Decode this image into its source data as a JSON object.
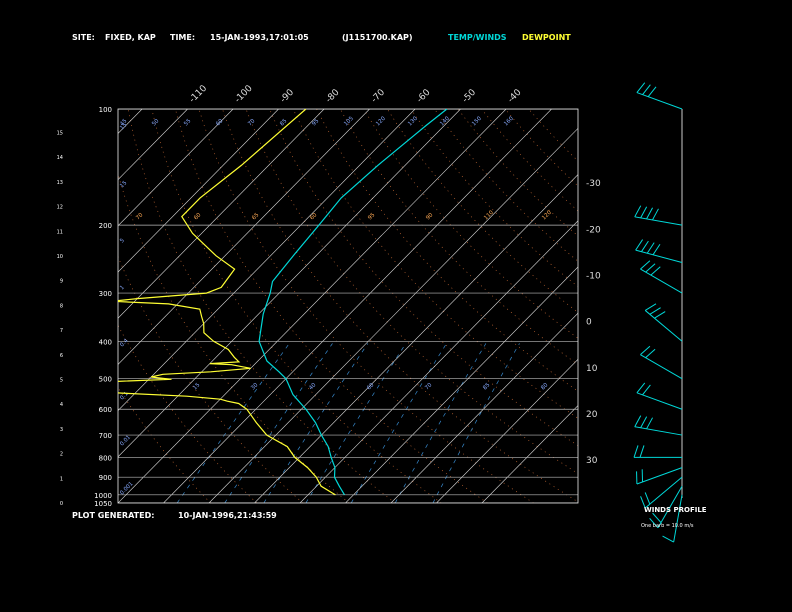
{
  "header": {
    "site_label": "SITE:",
    "site_value": "FIXED, KAP",
    "time_label": "TIME:",
    "time_value": "15-JAN-1993,17:01:05",
    "file_name": "(J1151700.KAP)",
    "temp_legend": "TEMP/WINDS",
    "dew_legend": "DEWPOINT"
  },
  "footer": {
    "generated_label": "PLOT GENERATED:",
    "generated_value": "10-JAN-1996,21:43:59",
    "winds_title": "WINDS PROFILE",
    "winds_note": "One barb = 10.0 m/s"
  },
  "colors": {
    "background": "#000000",
    "temperature": "#00d8d8",
    "dewpoint": "#ffff33",
    "isobar": "#bbbbbb",
    "isotherm": "#dddddd",
    "dry_adiabat": "#ff8844",
    "moist_adiabat": "#ffaa55",
    "mixing_ratio": "#44aaff",
    "labels": "#ffffff"
  },
  "chart_data": {
    "type": "line",
    "pressure_ticks": [
      "100",
      "200",
      "300",
      "400",
      "500",
      "600",
      "700",
      "800",
      "900",
      "1000",
      "1050"
    ],
    "height_ticks": [
      "0",
      "1",
      "2",
      "3",
      "4",
      "5",
      "6",
      "7",
      "8",
      "9",
      "10",
      "11",
      "12",
      "13",
      "14",
      "15"
    ],
    "isotherm_labels": [
      "-110",
      "-100",
      "-90",
      "-80",
      "-70",
      "-60",
      "-50",
      "-40",
      "-30",
      "-20",
      "-10",
      "0",
      "10",
      "20",
      "30"
    ],
    "mixing_ratio_labels": [
      "15",
      "15",
      "5",
      "1",
      "0.4",
      "0.1",
      "0.01",
      "0.001"
    ],
    "theta_labels_top": [
      "45",
      "50",
      "55",
      "60",
      "70",
      "85",
      "95",
      "105",
      "120",
      "130",
      "140",
      "150",
      "160"
    ],
    "theta_labels_mid": [
      "70",
      "60",
      "65",
      "60",
      "95",
      "90",
      "110",
      "120"
    ],
    "theta_labels_low": [
      "15",
      "30",
      "40",
      "60",
      "70",
      "85",
      "80"
    ],
    "series": [
      {
        "name": "TEMP/WINDS",
        "points": [
          [
            100,
            -53
          ],
          [
            110,
            -54
          ],
          [
            140,
            -56
          ],
          [
            170,
            -57
          ],
          [
            200,
            -56
          ],
          [
            240,
            -55
          ],
          [
            280,
            -54
          ],
          [
            300,
            -52
          ],
          [
            340,
            -49
          ],
          [
            400,
            -44
          ],
          [
            450,
            -38
          ],
          [
            480,
            -33
          ],
          [
            500,
            -30
          ],
          [
            550,
            -25
          ],
          [
            600,
            -19
          ],
          [
            650,
            -14
          ],
          [
            700,
            -10
          ],
          [
            750,
            -6
          ],
          [
            800,
            -3
          ],
          [
            850,
            0
          ],
          [
            900,
            2
          ],
          [
            950,
            5
          ],
          [
            1000,
            8
          ]
        ]
      },
      {
        "name": "DEWPOINT",
        "points": [
          [
            100,
            -84
          ],
          [
            140,
            -86
          ],
          [
            170,
            -88
          ],
          [
            190,
            -88
          ],
          [
            210,
            -82
          ],
          [
            240,
            -72
          ],
          [
            260,
            -65
          ],
          [
            290,
            -64
          ],
          [
            300,
            -66
          ],
          [
            310,
            -80
          ],
          [
            315,
            -85
          ],
          [
            320,
            -72
          ],
          [
            330,
            -64
          ],
          [
            345,
            -62
          ],
          [
            360,
            -60
          ],
          [
            380,
            -58
          ],
          [
            400,
            -54
          ],
          [
            420,
            -49
          ],
          [
            440,
            -46
          ],
          [
            452,
            -44
          ],
          [
            457,
            -50
          ],
          [
            460,
            -45
          ],
          [
            470,
            -40
          ],
          [
            480,
            -48
          ],
          [
            487,
            -58
          ],
          [
            495,
            -60
          ],
          [
            502,
            -55
          ],
          [
            510,
            -70
          ],
          [
            515,
            -82
          ],
          [
            518,
            -78
          ],
          [
            525,
            -70
          ],
          [
            530,
            -80
          ],
          [
            538,
            -72
          ],
          [
            545,
            -63
          ],
          [
            555,
            -48
          ],
          [
            560,
            -44
          ],
          [
            565,
            -40
          ],
          [
            572,
            -38
          ],
          [
            580,
            -35
          ],
          [
            600,
            -32
          ],
          [
            650,
            -27
          ],
          [
            700,
            -22
          ],
          [
            750,
            -15
          ],
          [
            800,
            -11
          ],
          [
            850,
            -6
          ],
          [
            900,
            -2
          ],
          [
            950,
            1
          ],
          [
            990,
            5
          ],
          [
            1000,
            6
          ]
        ]
      }
    ],
    "winds": [
      {
        "p": 100,
        "dir": 290,
        "spd": 25
      },
      {
        "p": 200,
        "dir": 280,
        "spd": 35
      },
      {
        "p": 250,
        "dir": 285,
        "spd": 40
      },
      {
        "p": 300,
        "dir": 300,
        "spd": 30
      },
      {
        "p": 400,
        "dir": 310,
        "spd": 25
      },
      {
        "p": 500,
        "dir": 300,
        "spd": 20
      },
      {
        "p": 600,
        "dir": 290,
        "spd": 20
      },
      {
        "p": 700,
        "dir": 280,
        "spd": 25
      },
      {
        "p": 800,
        "dir": 270,
        "spd": 20
      },
      {
        "p": 850,
        "dir": 250,
        "spd": 15
      },
      {
        "p": 900,
        "dir": 230,
        "spd": 15
      },
      {
        "p": 950,
        "dir": 210,
        "spd": 15
      },
      {
        "p": 1000,
        "dir": 190,
        "spd": 10
      }
    ],
    "xlim": [
      -110,
      40
    ],
    "ylim": [
      1050,
      100
    ],
    "grid": true
  }
}
